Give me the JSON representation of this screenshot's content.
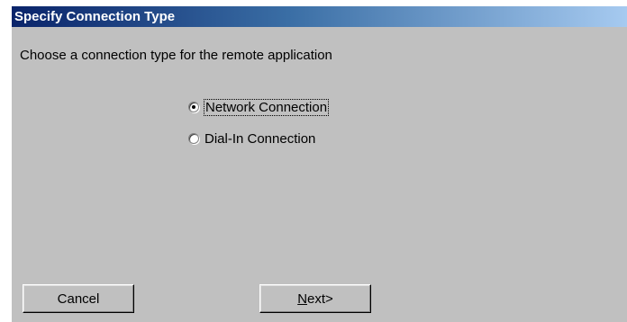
{
  "dialog": {
    "title": "Specify Connection Type",
    "prompt": "Choose a connection type for the remote application",
    "options": [
      {
        "label": "Network Connection",
        "selected": true,
        "focused": true
      },
      {
        "label": "Dial-In Connection",
        "selected": false,
        "focused": false
      }
    ],
    "buttons": {
      "cancel_label": "Cancel",
      "next_mnemonic": "N",
      "next_rest": "ext>"
    }
  },
  "colors": {
    "face": "#c0c0c0",
    "title_start": "#0a246a",
    "title_end": "#a6caf0",
    "title_text": "#ffffff"
  },
  "icons": {
    "radio_selected": "radio-selected-icon",
    "radio_unselected": "radio-unselected-icon"
  }
}
